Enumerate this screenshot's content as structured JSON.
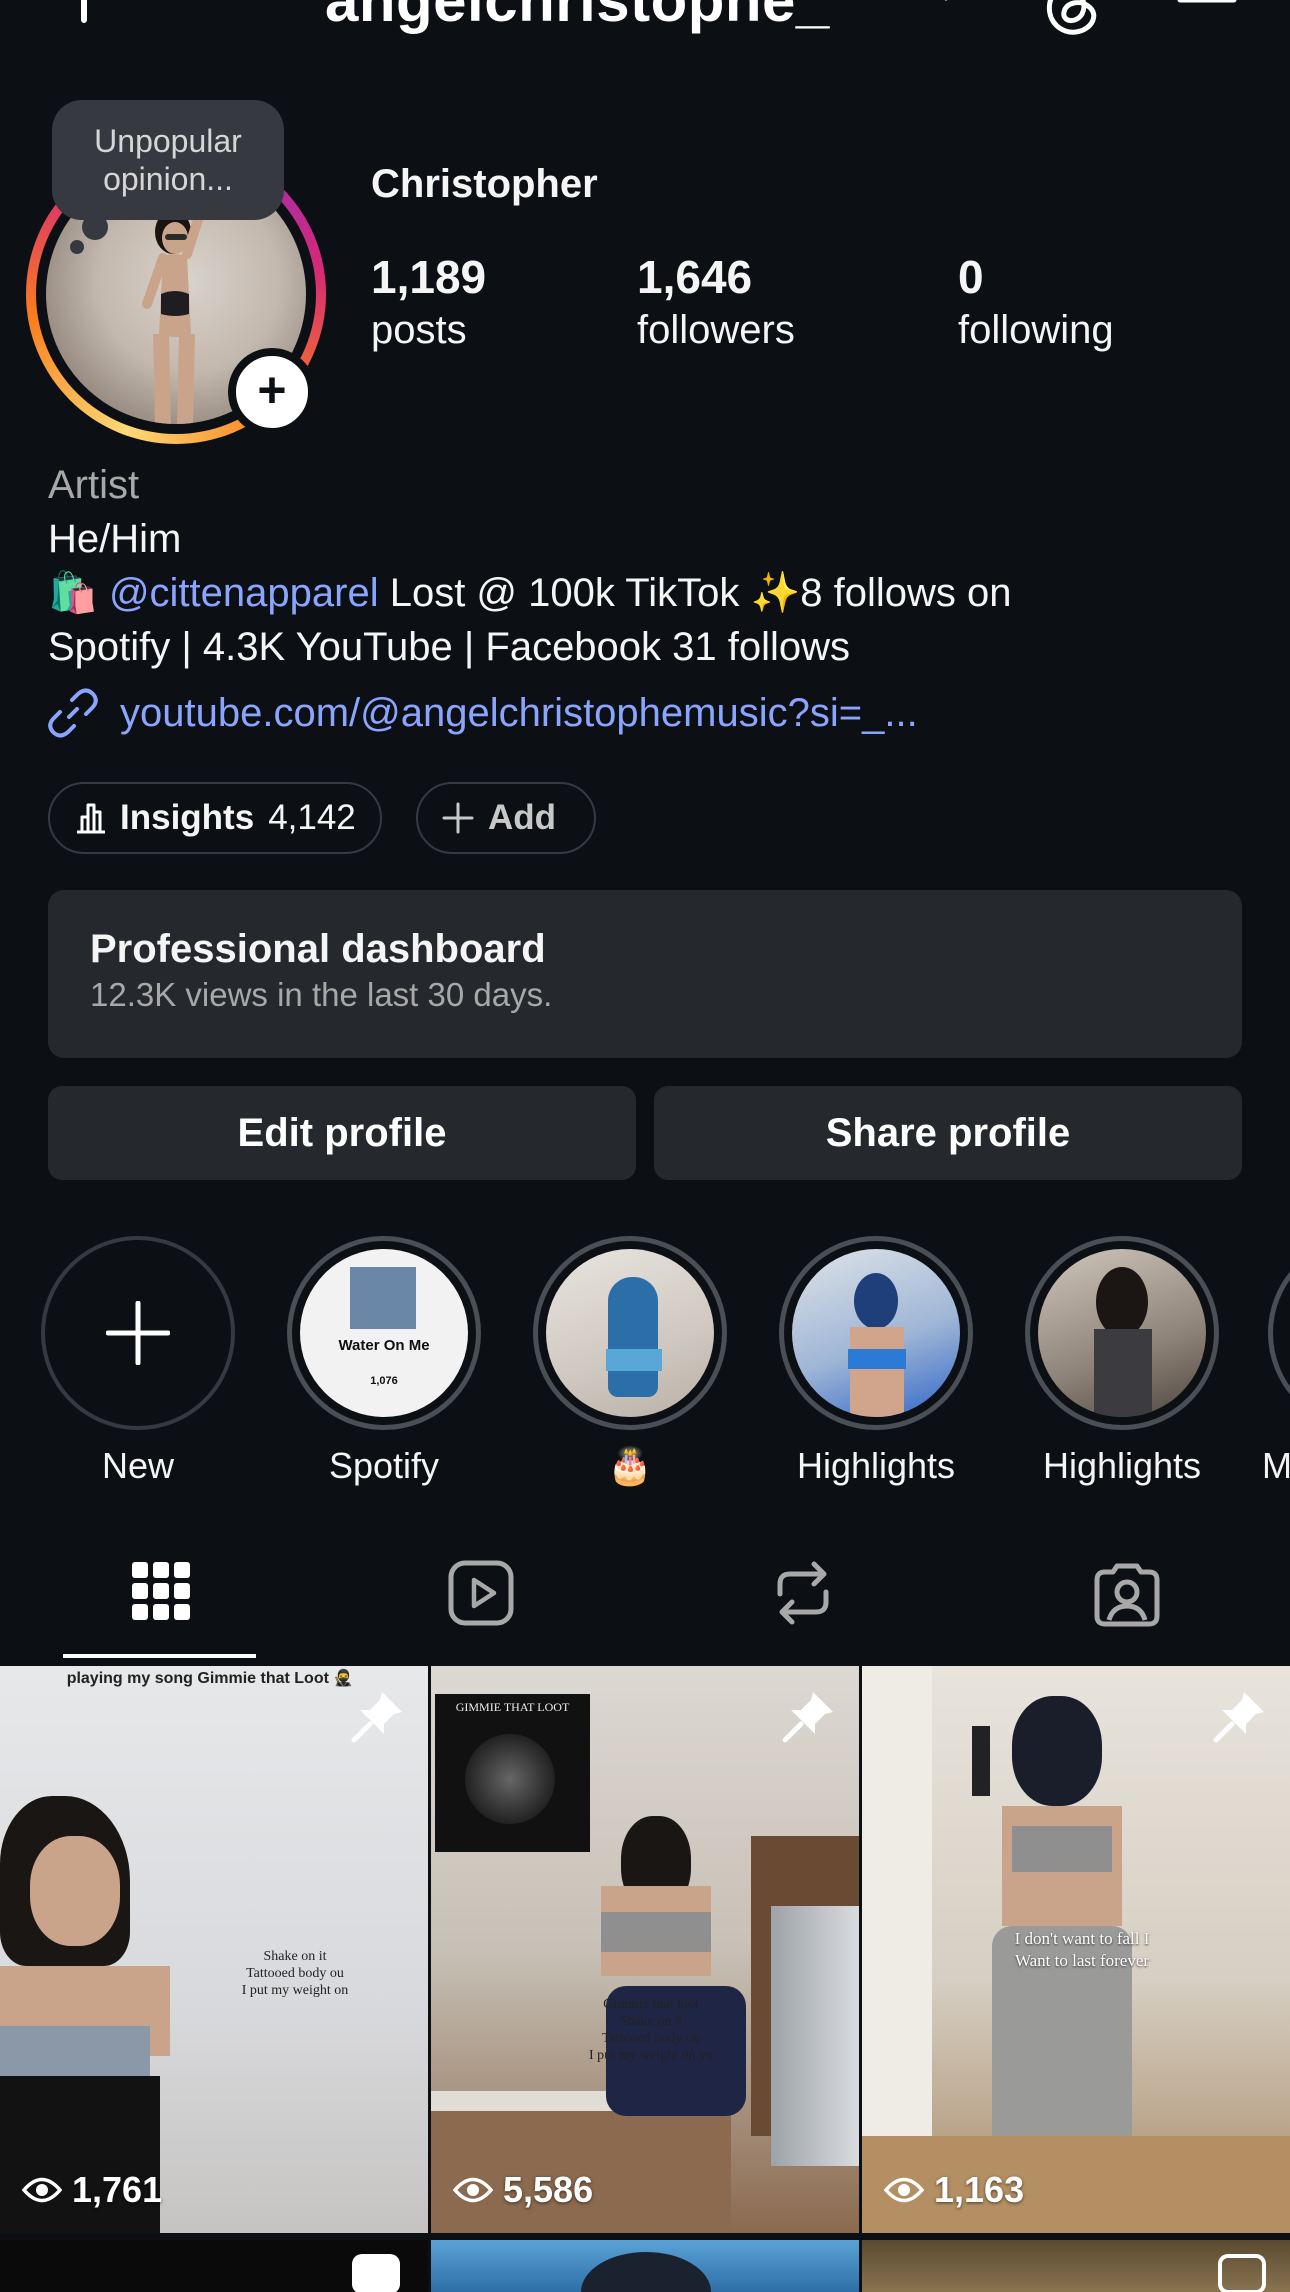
{
  "header": {
    "username": "angelchristophe_"
  },
  "note": {
    "text_line1": "Unpopular",
    "text_line2": "opinion..."
  },
  "profile": {
    "display_name": "Christopher",
    "stats": [
      {
        "value": "1,189",
        "label": "posts"
      },
      {
        "value": "1,646",
        "label": "followers"
      },
      {
        "value": "0",
        "label": "following"
      }
    ],
    "category": "Artist",
    "pronouns": "He/Him",
    "bio_emoji": "🛍️",
    "bio_mention": "@cittenapparel",
    "bio_line1_rest": " Lost @ 100k TikTok ✨8 follows on",
    "bio_line2": "Spotify | 4.3K YouTube | Facebook 31 follows",
    "link": "youtube.com/@angelchristophemusic?si=_..."
  },
  "chips": {
    "insights_label": "Insights",
    "insights_count": "4,142",
    "add_label": "Add"
  },
  "dashboard": {
    "title": "Professional dashboard",
    "subtitle": "12.3K views in the last 30 days."
  },
  "buttons": {
    "edit": "Edit profile",
    "share": "Share profile"
  },
  "highlights": [
    {
      "label": "New"
    },
    {
      "label": "Spotify",
      "cover_title": "Water On Me",
      "cover_count": "1,076"
    },
    {
      "label": "🎂"
    },
    {
      "label": "Highlights"
    },
    {
      "label": "Highlights"
    },
    {
      "label": "M"
    }
  ],
  "tabs": [
    "posts-grid",
    "reels",
    "reposts",
    "tagged"
  ],
  "grid": [
    {
      "views": "1,761",
      "caption_top": "playing my song Gimmie that Loot 🥷",
      "caption": "Shake on it\nTattooed body ou\nI put my weight on"
    },
    {
      "views": "5,586",
      "album_title": "GIMMIE THAT LOOT",
      "caption": "Gimmie that loot\nShake on it\nTattooed body ou\nI put my weight on yo"
    },
    {
      "views": "1,163",
      "caption": "I don't want to fall I\nWant to last forever"
    }
  ],
  "colors": {
    "background": "#0c1014",
    "surface": "#25292e",
    "link": "#8ba5ff"
  }
}
